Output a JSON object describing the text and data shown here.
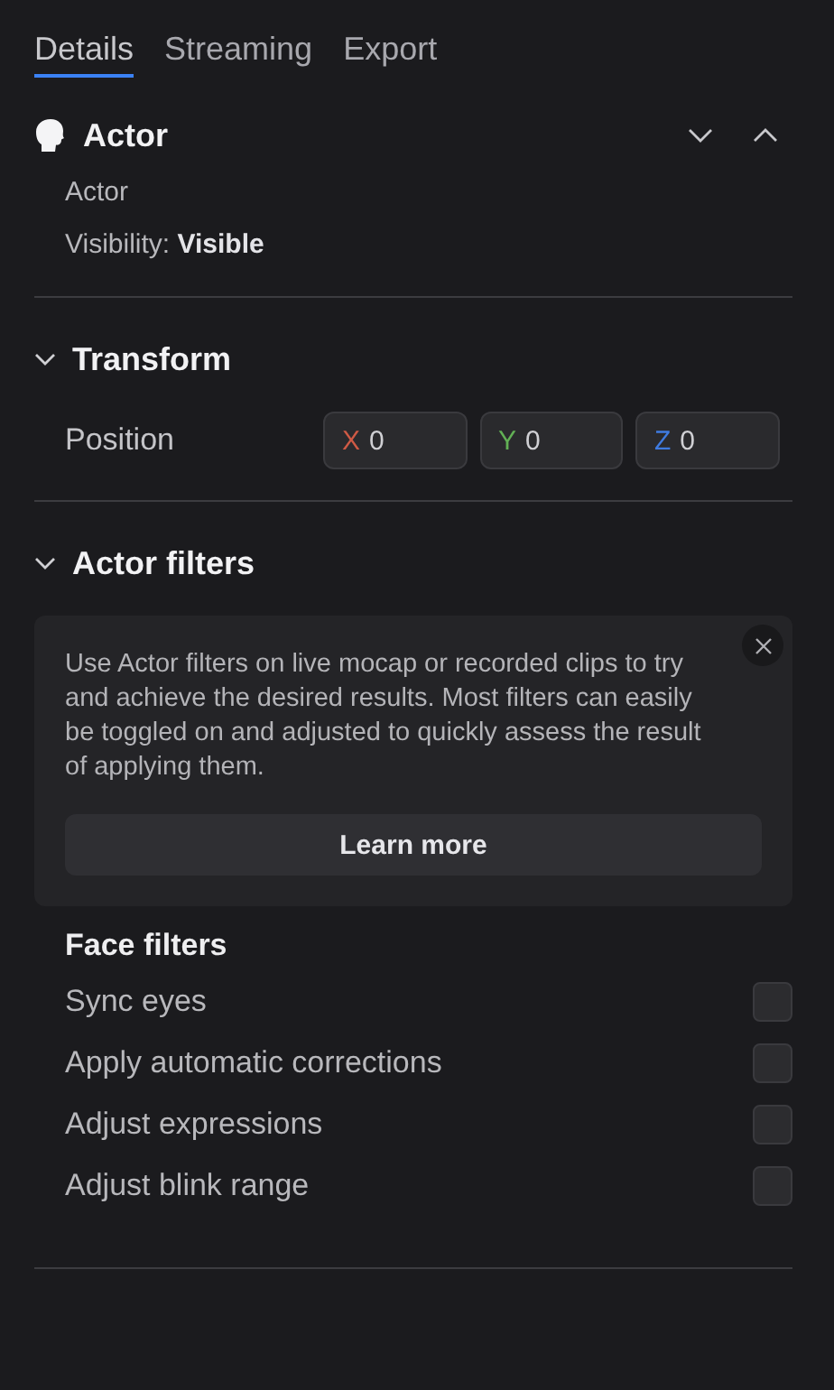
{
  "tabs": [
    {
      "label": "Details",
      "selected": true
    },
    {
      "label": "Streaming",
      "selected": false
    },
    {
      "label": "Export",
      "selected": false
    }
  ],
  "actor": {
    "title": "Actor",
    "name": "Actor",
    "visibility_label": "Visibility:",
    "visibility_value": "Visible"
  },
  "transform": {
    "title": "Transform",
    "expanded": true,
    "position_label": "Position",
    "fields": [
      {
        "axis": "X",
        "value": "0",
        "color": "#cf5a45"
      },
      {
        "axis": "Y",
        "value": "0",
        "color": "#62b055"
      },
      {
        "axis": "Z",
        "value": "0",
        "color": "#3f7be0"
      }
    ]
  },
  "actor_filters": {
    "title": "Actor filters",
    "expanded": true,
    "info": {
      "text": "Use Actor filters on live mocap or recorded clips to try and achieve the desired results. Most filters can easily be toggled on and adjusted to quickly assess the result of applying them.",
      "button": "Learn more"
    },
    "group_title": "Face filters",
    "filters": [
      {
        "label": "Sync eyes",
        "checked": false
      },
      {
        "label": "Apply automatic corrections",
        "checked": false
      },
      {
        "label": "Adjust expressions",
        "checked": false
      },
      {
        "label": "Adjust blink range",
        "checked": false
      }
    ]
  }
}
